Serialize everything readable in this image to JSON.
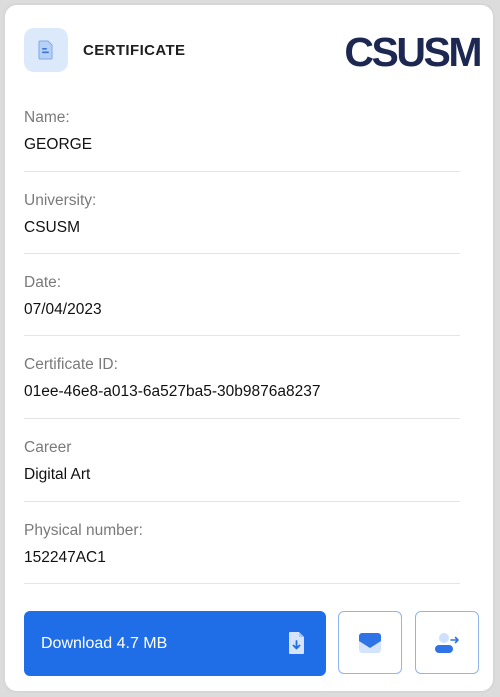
{
  "header": {
    "title": "CERTIFICATE",
    "logo_text": "CSUSM",
    "badge_icon": "document-icon"
  },
  "fields": [
    {
      "label": "Name:",
      "value": "GEORGE"
    },
    {
      "label": "University:",
      "value": "CSUSM"
    },
    {
      "label": "Date:",
      "value": "07/04/2023"
    },
    {
      "label": "Certificate ID:",
      "value": "01ee-46e8-a013-6a527ba5-30b9876a8237"
    },
    {
      "label": "Career",
      "value": "Digital Art"
    },
    {
      "label": "Physical number:",
      "value": "152247AC1"
    }
  ],
  "actions": {
    "download_label": "Download 4.7 MB",
    "download_icon": "file-download-icon",
    "email_icon": "envelope-icon",
    "share_icon": "user-share-icon"
  },
  "colors": {
    "accent": "#1f6ee8",
    "brand": "#1c2851",
    "badge_bg": "#dce9fb"
  }
}
